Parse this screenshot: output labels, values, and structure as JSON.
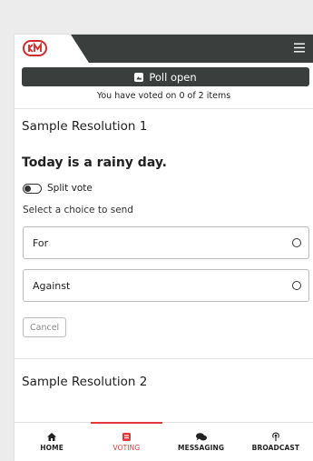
{
  "header": {
    "logo_icon": "km-logo-icon",
    "menu_icon": "hamburger-menu-icon"
  },
  "poll": {
    "banner_label": "Poll open",
    "banner_icon": "chart-icon",
    "voted_status": "You have voted on 0 of 2 items"
  },
  "resolution_1": {
    "title": "Sample Resolution 1",
    "question": "Today is a rainy day.",
    "split_vote_label": "Split vote",
    "split_vote_on": false,
    "select_prompt": "Select a choice to send",
    "choices": [
      {
        "label": "For"
      },
      {
        "label": "Against"
      }
    ],
    "cancel_label": "Cancel"
  },
  "resolution_2": {
    "title": "Sample Resolution 2"
  },
  "nav": {
    "items": [
      {
        "label": "HOME",
        "icon": "home-icon"
      },
      {
        "label": "VOTING",
        "icon": "voting-icon",
        "active": true
      },
      {
        "label": "MESSAGING",
        "icon": "chat-bubbles-icon"
      },
      {
        "label": "BROADCAST",
        "icon": "broadcast-icon"
      }
    ]
  },
  "colors": {
    "header_bg": "#3a3f3e",
    "accent": "#e23a3a",
    "page_bg": "#ececec"
  }
}
